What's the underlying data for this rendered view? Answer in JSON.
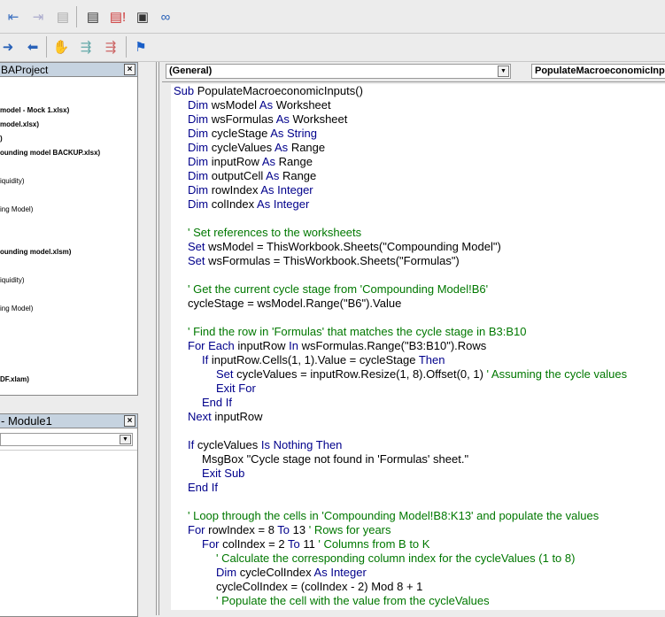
{
  "toolbar": {
    "row1_icons": [
      "indent-icon",
      "outdent-icon",
      "properties-window-icon",
      "code-window-icon",
      "immediate-window-icon",
      "watch-window-icon",
      "quick-watch-icon"
    ],
    "row2_icons": [
      "step-into-icon",
      "step-out-icon",
      "breakpoint-hand-icon",
      "comment-block-icon",
      "uncomment-block-icon",
      "bookmark-flag-icon"
    ]
  },
  "project_pane": {
    "title": "BAProject",
    "items": [
      {
        "label": "model - Mock 1.xlsx)",
        "bold": true
      },
      {
        "label": "model.xlsx)",
        "bold": true
      },
      {
        "label": ")",
        "bold": true
      },
      {
        "label": "ounding model BACKUP.xlsx)",
        "bold": true
      },
      {
        "label": "iquidity)",
        "bold": false
      },
      {
        "label": "ing Model)",
        "bold": false
      },
      {
        "label": "ounding model.xlsm)",
        "bold": true
      },
      {
        "label": "iquidity)",
        "bold": false
      },
      {
        "label": "ing Model)",
        "bold": false
      },
      {
        "label": "DF.xlam)",
        "bold": true
      }
    ]
  },
  "properties_pane": {
    "title": "- Module1"
  },
  "code_window": {
    "object_combo": "(General)",
    "procedure_combo": "PopulateMacroeconomicInputs",
    "lines": [
      {
        "i": 0,
        "s": [
          [
            "k",
            "Sub "
          ],
          [
            "t",
            "PopulateMacroeconomicInputs()"
          ]
        ]
      },
      {
        "i": 1,
        "s": [
          [
            "k",
            "Dim "
          ],
          [
            "t",
            "wsModel "
          ],
          [
            "k",
            "As "
          ],
          [
            "t",
            "Worksheet"
          ]
        ]
      },
      {
        "i": 1,
        "s": [
          [
            "k",
            "Dim "
          ],
          [
            "t",
            "wsFormulas "
          ],
          [
            "k",
            "As "
          ],
          [
            "t",
            "Worksheet"
          ]
        ]
      },
      {
        "i": 1,
        "s": [
          [
            "k",
            "Dim "
          ],
          [
            "t",
            "cycleStage "
          ],
          [
            "k",
            "As String"
          ]
        ]
      },
      {
        "i": 1,
        "s": [
          [
            "k",
            "Dim "
          ],
          [
            "t",
            "cycleValues "
          ],
          [
            "k",
            "As "
          ],
          [
            "t",
            "Range"
          ]
        ]
      },
      {
        "i": 1,
        "s": [
          [
            "k",
            "Dim "
          ],
          [
            "t",
            "inputRow "
          ],
          [
            "k",
            "As "
          ],
          [
            "t",
            "Range"
          ]
        ]
      },
      {
        "i": 1,
        "s": [
          [
            "k",
            "Dim "
          ],
          [
            "t",
            "outputCell "
          ],
          [
            "k",
            "As "
          ],
          [
            "t",
            "Range"
          ]
        ]
      },
      {
        "i": 1,
        "s": [
          [
            "k",
            "Dim "
          ],
          [
            "t",
            "rowIndex "
          ],
          [
            "k",
            "As Integer"
          ]
        ]
      },
      {
        "i": 1,
        "s": [
          [
            "k",
            "Dim "
          ],
          [
            "t",
            "colIndex "
          ],
          [
            "k",
            "As Integer"
          ]
        ]
      },
      {
        "i": 0,
        "s": []
      },
      {
        "i": 1,
        "s": [
          [
            "c",
            "' Set references to the worksheets"
          ]
        ]
      },
      {
        "i": 1,
        "s": [
          [
            "k",
            "Set "
          ],
          [
            "t",
            "wsModel = ThisWorkbook.Sheets(\"Compounding Model\")"
          ]
        ]
      },
      {
        "i": 1,
        "s": [
          [
            "k",
            "Set "
          ],
          [
            "t",
            "wsFormulas = ThisWorkbook.Sheets(\"Formulas\")"
          ]
        ]
      },
      {
        "i": 0,
        "s": []
      },
      {
        "i": 1,
        "s": [
          [
            "c",
            "' Get the current cycle stage from 'Compounding Model!B6'"
          ]
        ]
      },
      {
        "i": 1,
        "s": [
          [
            "t",
            "cycleStage = wsModel.Range(\"B6\").Value"
          ]
        ]
      },
      {
        "i": 0,
        "s": []
      },
      {
        "i": 1,
        "s": [
          [
            "c",
            "' Find the row in 'Formulas' that matches the cycle stage in B3:B10"
          ]
        ]
      },
      {
        "i": 1,
        "s": [
          [
            "k",
            "For Each "
          ],
          [
            "t",
            "inputRow "
          ],
          [
            "k",
            "In "
          ],
          [
            "t",
            "wsFormulas.Range(\"B3:B10\").Rows"
          ]
        ]
      },
      {
        "i": 2,
        "s": [
          [
            "k",
            "If "
          ],
          [
            "t",
            "inputRow.Cells(1, 1).Value = cycleStage "
          ],
          [
            "k",
            "Then"
          ]
        ]
      },
      {
        "i": 3,
        "s": [
          [
            "k",
            "Set "
          ],
          [
            "t",
            "cycleValues = inputRow.Resize(1, 8).Offset(0, 1) "
          ],
          [
            "c",
            "' Assuming the cycle values"
          ]
        ]
      },
      {
        "i": 3,
        "s": [
          [
            "k",
            "Exit For"
          ]
        ]
      },
      {
        "i": 2,
        "s": [
          [
            "k",
            "End If"
          ]
        ]
      },
      {
        "i": 1,
        "s": [
          [
            "k",
            "Next "
          ],
          [
            "t",
            "inputRow"
          ]
        ]
      },
      {
        "i": 0,
        "s": []
      },
      {
        "i": 1,
        "s": [
          [
            "k",
            "If "
          ],
          [
            "t",
            "cycleValues "
          ],
          [
            "k",
            "Is Nothing Then"
          ]
        ]
      },
      {
        "i": 2,
        "s": [
          [
            "t",
            "MsgBox \"Cycle stage not found in 'Formulas' sheet.\""
          ]
        ]
      },
      {
        "i": 2,
        "s": [
          [
            "k",
            "Exit Sub"
          ]
        ]
      },
      {
        "i": 1,
        "s": [
          [
            "k",
            "End If"
          ]
        ]
      },
      {
        "i": 0,
        "s": []
      },
      {
        "i": 1,
        "s": [
          [
            "c",
            "' Loop through the cells in 'Compounding Model!B8:K13' and populate the values"
          ]
        ]
      },
      {
        "i": 1,
        "s": [
          [
            "k",
            "For "
          ],
          [
            "t",
            "rowIndex = 8 "
          ],
          [
            "k",
            "To "
          ],
          [
            "t",
            "13 "
          ],
          [
            "c",
            "' Rows for years"
          ]
        ]
      },
      {
        "i": 2,
        "s": [
          [
            "k",
            "For "
          ],
          [
            "t",
            "colIndex = 2 "
          ],
          [
            "k",
            "To "
          ],
          [
            "t",
            "11 "
          ],
          [
            "c",
            "' Columns from B to K"
          ]
        ]
      },
      {
        "i": 3,
        "s": [
          [
            "c",
            "' Calculate the corresponding column index for the cycleValues (1 to 8)"
          ]
        ]
      },
      {
        "i": 3,
        "s": [
          [
            "k",
            "Dim "
          ],
          [
            "t",
            "cycleColIndex "
          ],
          [
            "k",
            "As Integer"
          ]
        ]
      },
      {
        "i": 3,
        "s": [
          [
            "t",
            "cycleColIndex = (colIndex - 2) Mod 8 + 1"
          ]
        ]
      },
      {
        "i": 3,
        "s": [
          [
            "c",
            "' Populate the cell with the value from the cycleValues"
          ]
        ]
      }
    ]
  }
}
